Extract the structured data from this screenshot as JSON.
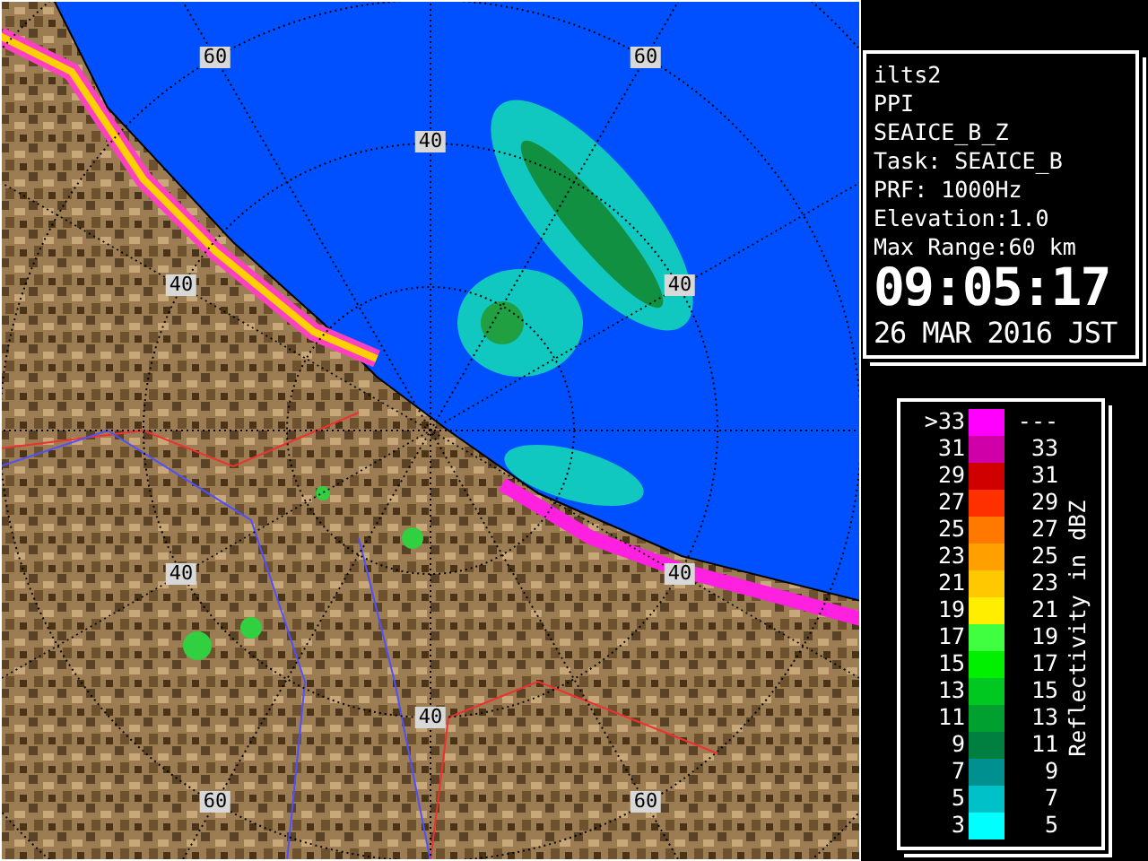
{
  "map": {
    "range_labels": [
      "60",
      "60",
      "40",
      "40",
      "40",
      "40",
      "40",
      "40",
      "60",
      "60"
    ]
  },
  "info": {
    "lines": [
      "ilts2",
      "PPI",
      "SEAICE_B_Z",
      "Task: SEAICE_B",
      "PRF: 1000Hz",
      "Elevation:1.0",
      "Max Range:60 km"
    ],
    "time": "09:05:17",
    "date": "26 MAR 2016 JST"
  },
  "legend": {
    "title": "Reflectivity in dBZ",
    "rows": [
      {
        "low": ">33",
        "high": "---",
        "color": "#ff00ff"
      },
      {
        "low": "31",
        "high": "33",
        "color": "#d000a8"
      },
      {
        "low": "29",
        "high": "31",
        "color": "#d00000"
      },
      {
        "low": "27",
        "high": "29",
        "color": "#ff3000"
      },
      {
        "low": "25",
        "high": "27",
        "color": "#ff7800"
      },
      {
        "low": "23",
        "high": "25",
        "color": "#ffa000"
      },
      {
        "low": "21",
        "high": "23",
        "color": "#ffc800"
      },
      {
        "low": "19",
        "high": "21",
        "color": "#ffee00"
      },
      {
        "low": "17",
        "high": "19",
        "color": "#40ff40"
      },
      {
        "low": "15",
        "high": "17",
        "color": "#00f000"
      },
      {
        "low": "13",
        "high": "15",
        "color": "#00c820"
      },
      {
        "low": "11",
        "high": "13",
        "color": "#00a030"
      },
      {
        "low": "9",
        "high": "11",
        "color": "#008040"
      },
      {
        "low": "7",
        "high": "9",
        "color": "#009090"
      },
      {
        "low": "5",
        "high": "7",
        "color": "#00c0c8"
      },
      {
        "low": "3",
        "high": "5",
        "color": "#00ffff"
      }
    ]
  }
}
